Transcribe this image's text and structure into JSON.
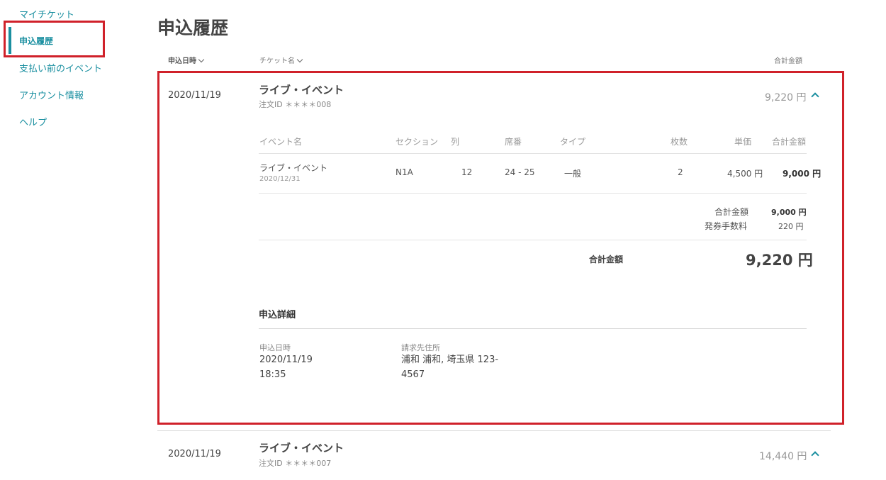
{
  "sidebar": {
    "items": [
      {
        "label": "マイチケット"
      },
      {
        "label": "申込履歴"
      },
      {
        "label": "支払い前のイベント"
      },
      {
        "label": "アカウント情報"
      },
      {
        "label": "ヘルプ"
      }
    ]
  },
  "page": {
    "title": "申込履歴"
  },
  "columns": {
    "date": "申込日時",
    "ticket": "チケット名",
    "total": "合計金額"
  },
  "orders": [
    {
      "date": "2020/11/19",
      "event": "ライブ・イベント",
      "order_id": "注文ID ＊＊＊＊008",
      "total": "9,220 円"
    },
    {
      "date": "2020/11/19",
      "event": "ライブ・イベント",
      "order_id": "注文ID ＊＊＊＊007",
      "total": "14,440 円"
    }
  ],
  "detail": {
    "headers": [
      "イベント名",
      "セクション",
      "列",
      "席番",
      "タイプ",
      "枚数",
      "単価",
      "合計金額"
    ],
    "row": {
      "event": "ライブ・イベント",
      "event_date": "2020/12/31",
      "section": "N1A",
      "row": "12",
      "seats": "24 - 25",
      "type": "一般",
      "qty": "2",
      "unit_price": "4,500 円",
      "subtotal": "9,000 円"
    },
    "summary": {
      "subtotal_label": "合計金額",
      "subtotal_value": "9,000 円",
      "fee_label": "発券手数料",
      "fee_value": "220 円",
      "grand_label": "合計金額",
      "grand_value": "9,220 円"
    },
    "application": {
      "title": "申込詳細",
      "date_label": "申込日時",
      "date_line1": "2020/11/19",
      "date_line2": "18:35",
      "address_label": "請求先住所",
      "address_line1": "浦和 浦和, 埼玉県 123-",
      "address_line2": "4567"
    }
  },
  "colors": {
    "accent": "#1a8fa0",
    "highlight": "#d0212a"
  }
}
